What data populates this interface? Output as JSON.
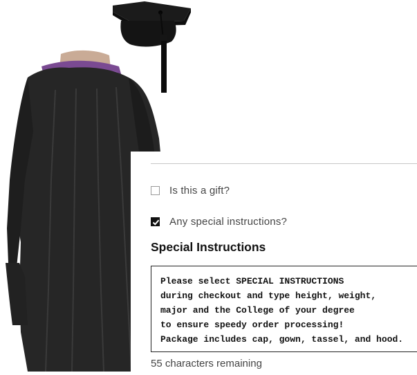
{
  "product": {
    "image_name": "cap-and-gown-image"
  },
  "options": {
    "gift": {
      "label": "Is this a gift?",
      "checked": false
    },
    "special_instructions": {
      "label": "Any special instructions?",
      "checked": true
    }
  },
  "special_instructions": {
    "title": "Special Instructions",
    "text": "Please select SPECIAL INSTRUCTIONS\nduring checkout and type height, weight,\nmajor and the College of your degree\nto ensure speedy order processing!\nPackage includes cap, gown, tassel, and hood.",
    "remaining": "55 characters remaining"
  }
}
